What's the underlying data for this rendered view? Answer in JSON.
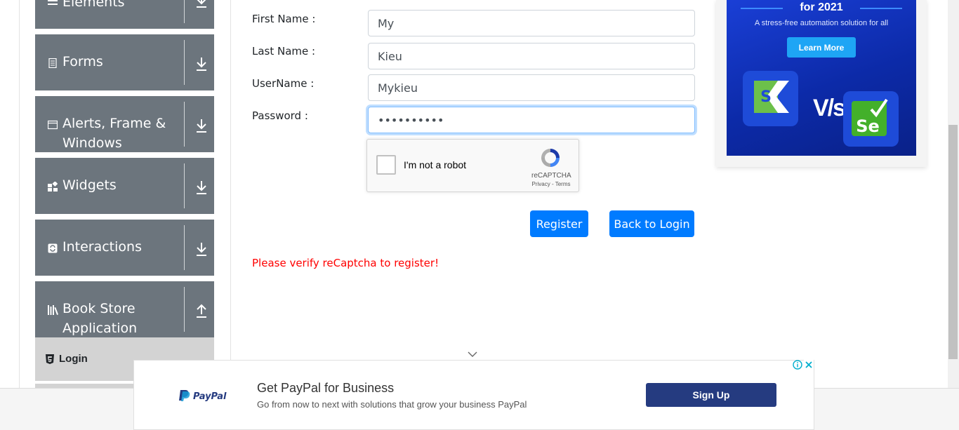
{
  "sidebar": {
    "groups": [
      {
        "label": "Elements",
        "icon": "menu-icon",
        "arrow": "download"
      },
      {
        "label": "Forms",
        "icon": "document-icon",
        "arrow": "download"
      },
      {
        "label": "Alerts, Frame &",
        "label2": "Windows",
        "icon": "window-icon",
        "arrow": "download"
      },
      {
        "label": "Widgets",
        "icon": "widgets-icon",
        "arrow": "download"
      },
      {
        "label": "Interactions",
        "icon": "interactions-icon",
        "arrow": "download"
      },
      {
        "label": "Book Store",
        "label2": "Application",
        "icon": "books-icon",
        "arrow": "upload"
      }
    ],
    "sub_items": [
      {
        "label": "Login",
        "icon": "html5-icon"
      }
    ]
  },
  "form": {
    "first_name_label": "First Name :",
    "first_name_value": "My",
    "last_name_label": "Last Name :",
    "last_name_value": "Kieu",
    "username_label": "UserName :",
    "username_value": "Mykieu",
    "password_label": "Password :",
    "password_value": "••••••••••",
    "captcha_label": "I'm not a robot",
    "captcha_brand": "reCAPTCHA",
    "captcha_terms": "Privacy - Terms",
    "register_button": "Register",
    "back_button": "Back to Login",
    "error_message": "Please verify reCaptcha to register!"
  },
  "ad_right": {
    "headline": "for 2021",
    "tagline": "A stress-free automation solution for all",
    "cta": "Learn More",
    "vs": "V/s"
  },
  "ad_bottom": {
    "brand": "PayPal",
    "title": "Get PayPal for Business",
    "subtitle": "Go from now to next with solutions that grow your business PayPal",
    "cta": "Sign Up"
  },
  "colors": {
    "sidebar_group": "#6c757d",
    "sidebar_sub_active": "#d3d3d3",
    "primary": "#007bff",
    "error": "#ff0000",
    "paypal_button": "#253b80"
  }
}
